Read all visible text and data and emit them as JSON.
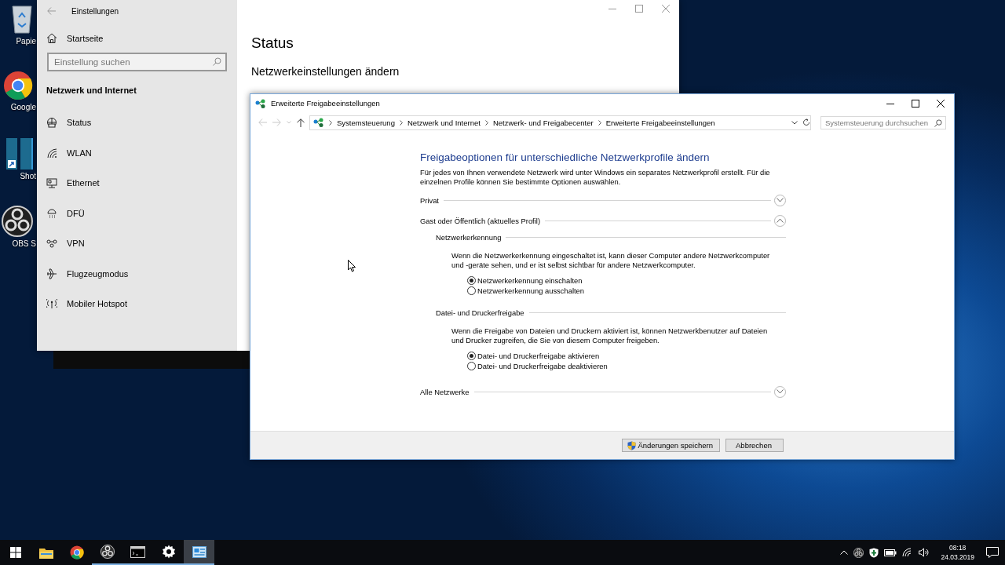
{
  "desktop": {
    "icons": [
      {
        "kind": "recycle-bin",
        "label": "Papie"
      },
      {
        "kind": "chrome",
        "label": "Google"
      },
      {
        "kind": "shortcut",
        "label": "Shot"
      },
      {
        "kind": "obs",
        "label": "OBS S"
      }
    ]
  },
  "settings_window": {
    "title": "Einstellungen",
    "home_label": "Startseite",
    "search": {
      "placeholder": "Einstellung suchen"
    },
    "section_title": "Netzwerk und Internet",
    "nav": [
      {
        "kind": "status",
        "label": "Status"
      },
      {
        "kind": "wlan",
        "label": "WLAN"
      },
      {
        "kind": "ethernet",
        "label": "Ethernet"
      },
      {
        "kind": "dialup",
        "label": "DFÜ"
      },
      {
        "kind": "vpn",
        "label": "VPN"
      },
      {
        "kind": "airplane",
        "label": "Flugzeugmodus"
      },
      {
        "kind": "hotspot",
        "label": "Mobiler Hotspot"
      }
    ],
    "page_title": "Status",
    "subheading": "Netzwerkeinstellungen ändern"
  },
  "control_panel": {
    "title": "Erweiterte Freigabeeinstellungen",
    "breadcrumb": [
      "Systemsteuerung",
      "Netzwerk und Internet",
      "Netzwerk- und Freigabecenter",
      "Erweiterte Freigabeeinstellungen"
    ],
    "search": {
      "placeholder": "Systemsteuerung durchsuchen"
    },
    "heading": "Freigabeoptionen für unterschiedliche Netzwerkprofile ändern",
    "intro": "Für jedes von Ihnen verwendete Netzwerk wird unter Windows ein separates Netzwerkprofil erstellt. Für die einzelnen Profile können Sie bestimmte Optionen auswählen.",
    "sections": [
      {
        "label": "Privat",
        "expanded": false
      },
      {
        "label": "Gast oder Öffentlich (aktuelles Profil)",
        "expanded": true,
        "groups": [
          {
            "title": "Netzwerkerkennung",
            "description": "Wenn die Netzwerkerkennung eingeschaltet ist, kann dieser Computer andere Netzwerkcomputer und -geräte sehen, und er ist selbst sichtbar für andere Netzwerkcomputer.",
            "options": [
              {
                "label": "Netzwerkerkennung einschalten",
                "selected": true
              },
              {
                "label": "Netzwerkerkennung ausschalten",
                "selected": false
              }
            ]
          },
          {
            "title": "Datei- und Druckerfreigabe",
            "description": "Wenn die Freigabe von Dateien und Druckern aktiviert ist, können Netzwerkbenutzer auf Dateien und Drucker zugreifen, die Sie von diesem Computer freigeben.",
            "options": [
              {
                "label": "Datei- und Druckerfreigabe aktivieren",
                "selected": true
              },
              {
                "label": "Datei- und Druckerfreigabe deaktivieren",
                "selected": false
              }
            ]
          }
        ]
      },
      {
        "label": "Alle Netzwerke",
        "expanded": false
      }
    ],
    "buttons": [
      {
        "kind": "admin",
        "label": "Änderungen speichern"
      },
      {
        "kind": "plain",
        "label": "Abbrechen"
      }
    ]
  },
  "taskbar": {
    "apps": [
      {
        "kind": "explorer",
        "running": false,
        "active": false
      },
      {
        "kind": "chrome",
        "running": false,
        "active": false
      },
      {
        "kind": "obs",
        "running": true,
        "active": false
      },
      {
        "kind": "terminal",
        "running": true,
        "active": false
      },
      {
        "kind": "settings",
        "running": true,
        "active": false
      },
      {
        "kind": "control-panel",
        "running": true,
        "active": true
      }
    ],
    "clock": {
      "time": "08:18",
      "date": "24.03.2019"
    }
  }
}
